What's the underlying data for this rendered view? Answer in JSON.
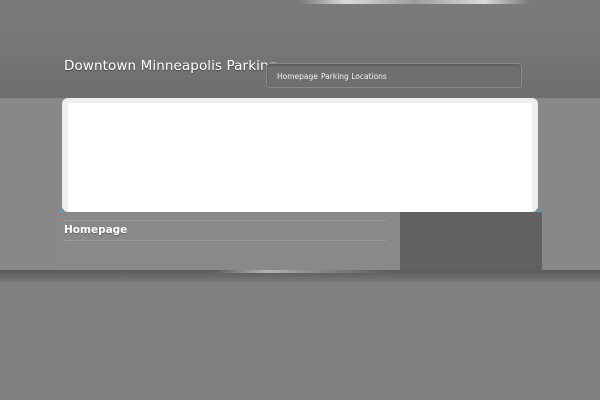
{
  "header": {
    "site_title": "Downtown Minneapolis Parking",
    "nav": {
      "items": [
        {
          "label": "Homepage"
        },
        {
          "label": "Parking Locations"
        }
      ]
    }
  },
  "main": {
    "page_heading": "Homepage"
  },
  "colors": {
    "background": "#808080",
    "header": "#767676",
    "sidebar": "#616161",
    "accent_blue": "#4aa0d8",
    "slider_background": "#ffffff"
  }
}
